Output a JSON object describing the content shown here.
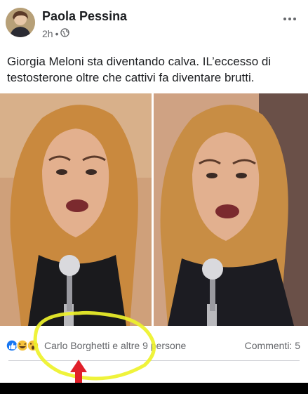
{
  "post": {
    "author": "Paola Pessina",
    "time": "2h",
    "separator": "•",
    "privacy_icon": "globe-icon",
    "more_icon": "more-dots-icon",
    "text": "Giorgia Meloni sta diventando calva. IL’eccesso di testosterone oltre che cattivi fa diventare brutti.",
    "photos": [
      "left-photo",
      "right-photo"
    ]
  },
  "footer": {
    "reaction_icons": [
      "like-icon",
      "haha-icon",
      "wow-icon"
    ],
    "reacted_by": "Carlo Borghetti e altre 9 persone",
    "comments": "Commenti: 5"
  },
  "annotation": {
    "highlight_color": "#eef22a",
    "arrow_color": "#e0202a"
  },
  "colors": {
    "text": "#1c1e21",
    "secondary_text": "#65676b",
    "like_blue": "#1877f2",
    "emoji_yellow": "#f7c33b"
  }
}
